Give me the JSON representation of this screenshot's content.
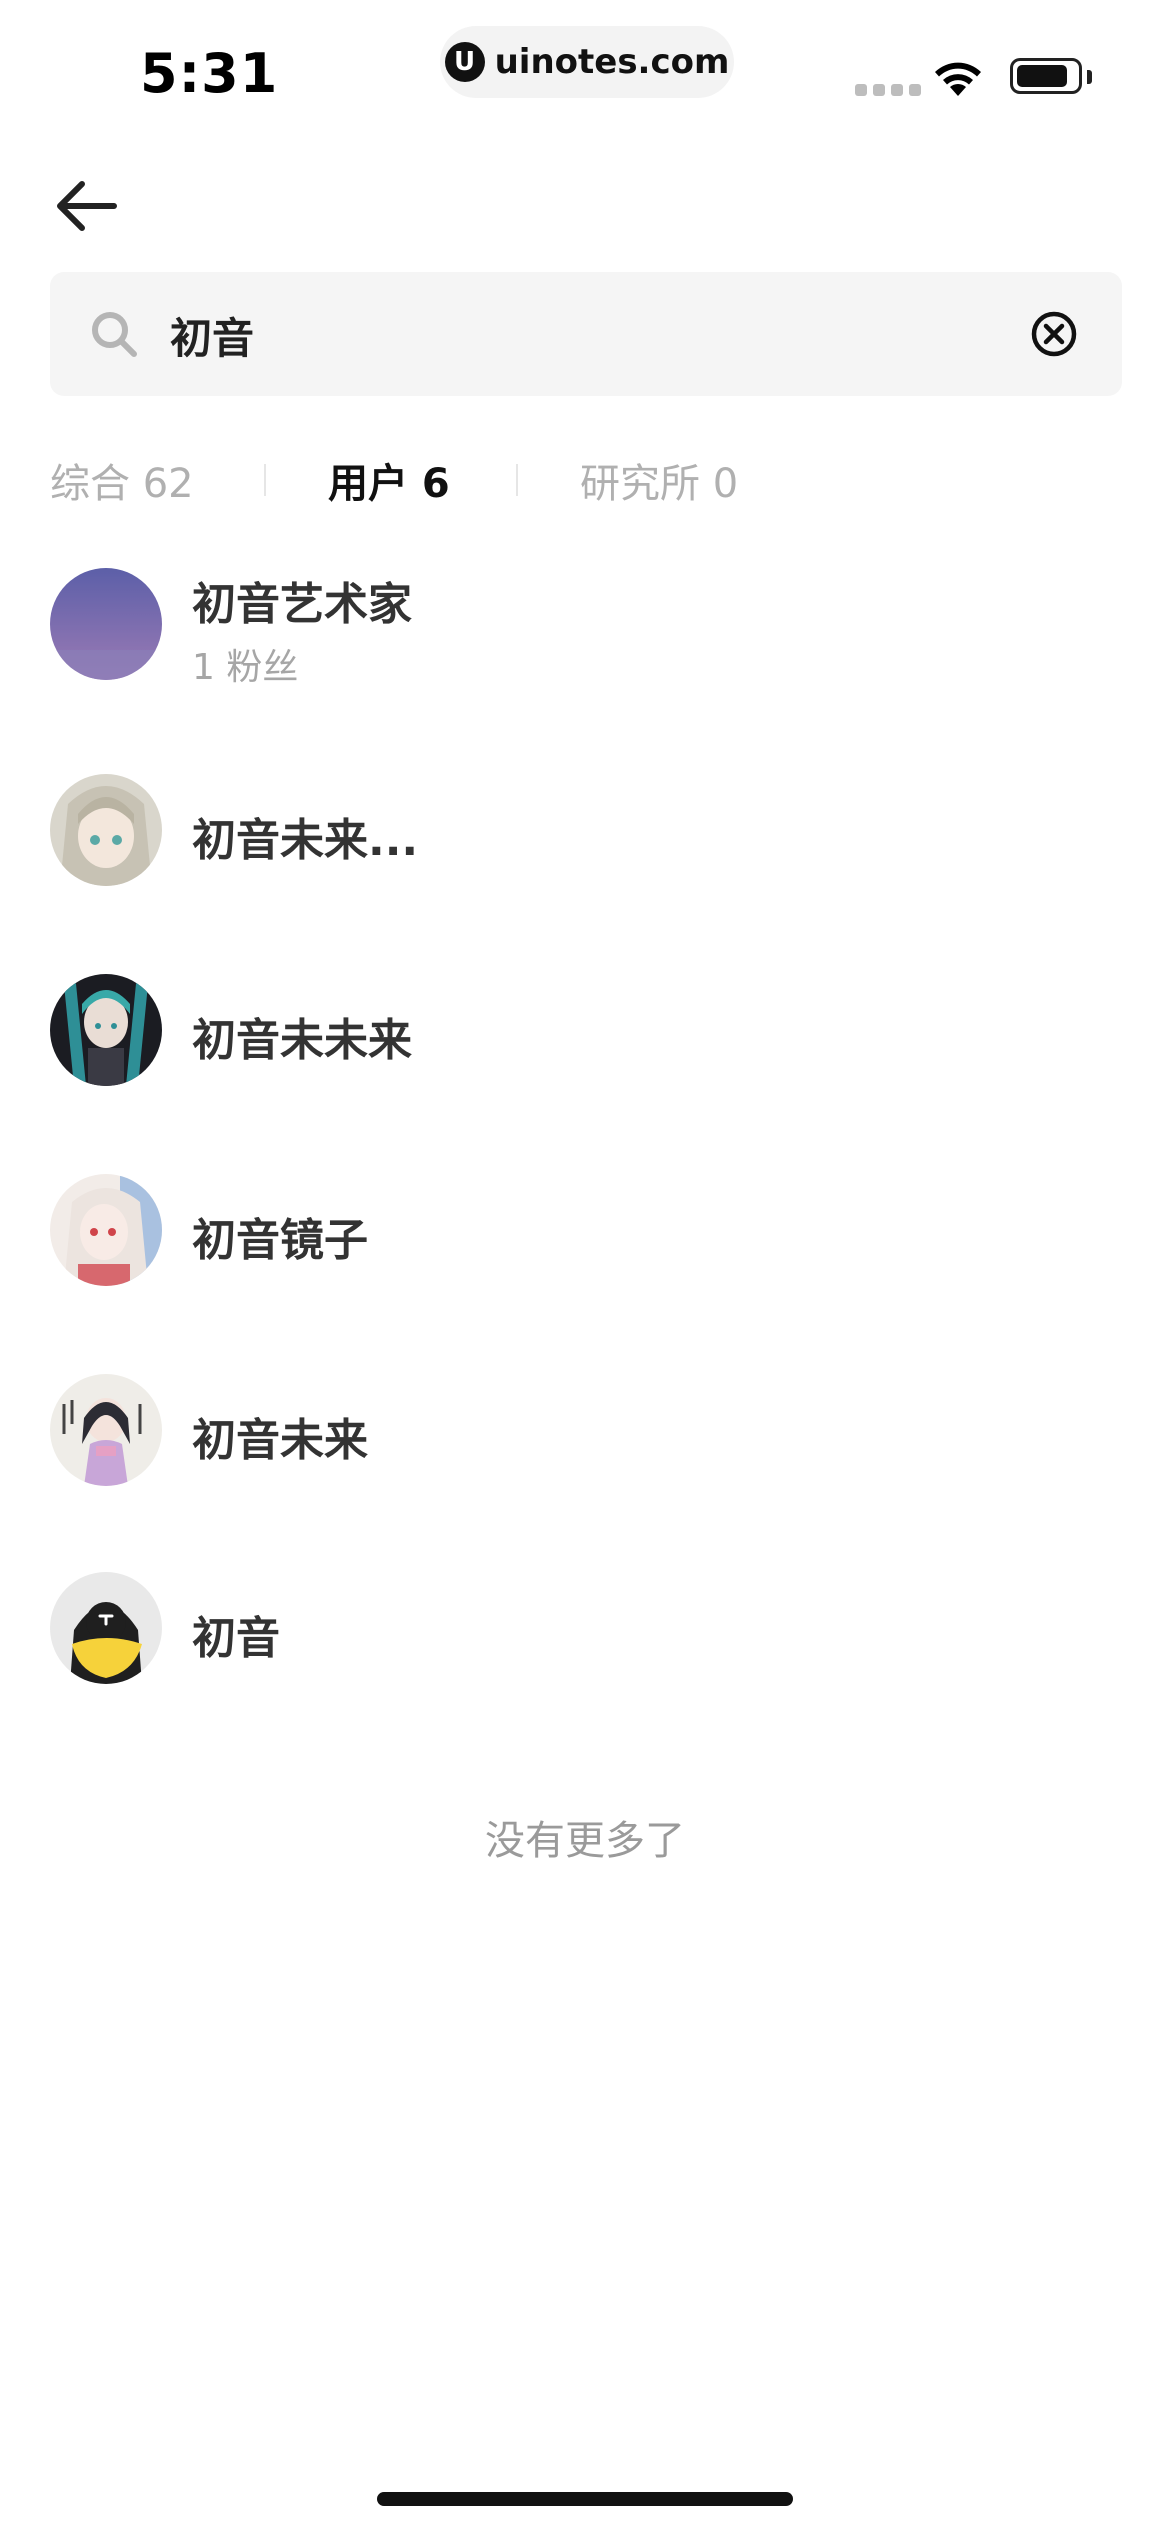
{
  "status_bar": {
    "time": "5:31",
    "url": "uinotes.com",
    "url_logo": "U"
  },
  "search": {
    "query": "初音",
    "placeholder": ""
  },
  "tabs": [
    {
      "label": "综合 62",
      "active": false
    },
    {
      "label": "用户 6",
      "active": true
    },
    {
      "label": "研究所 0",
      "active": false
    }
  ],
  "users": [
    {
      "name": "初音艺术家",
      "fans": "1 粉丝"
    },
    {
      "name": "初音未来..."
    },
    {
      "name": "初音未未来"
    },
    {
      "name": "初音镜子"
    },
    {
      "name": "初音未来"
    },
    {
      "name": "初音"
    }
  ],
  "footer": {
    "no_more": "没有更多了"
  },
  "icons": [
    "back-arrow-icon",
    "search-icon",
    "clear-icon",
    "wifi-icon",
    "battery-icon"
  ],
  "colors": {
    "active_tab": "#111111",
    "inactive_tab": "#b0b0b0",
    "search_bg": "#f5f5f5"
  }
}
